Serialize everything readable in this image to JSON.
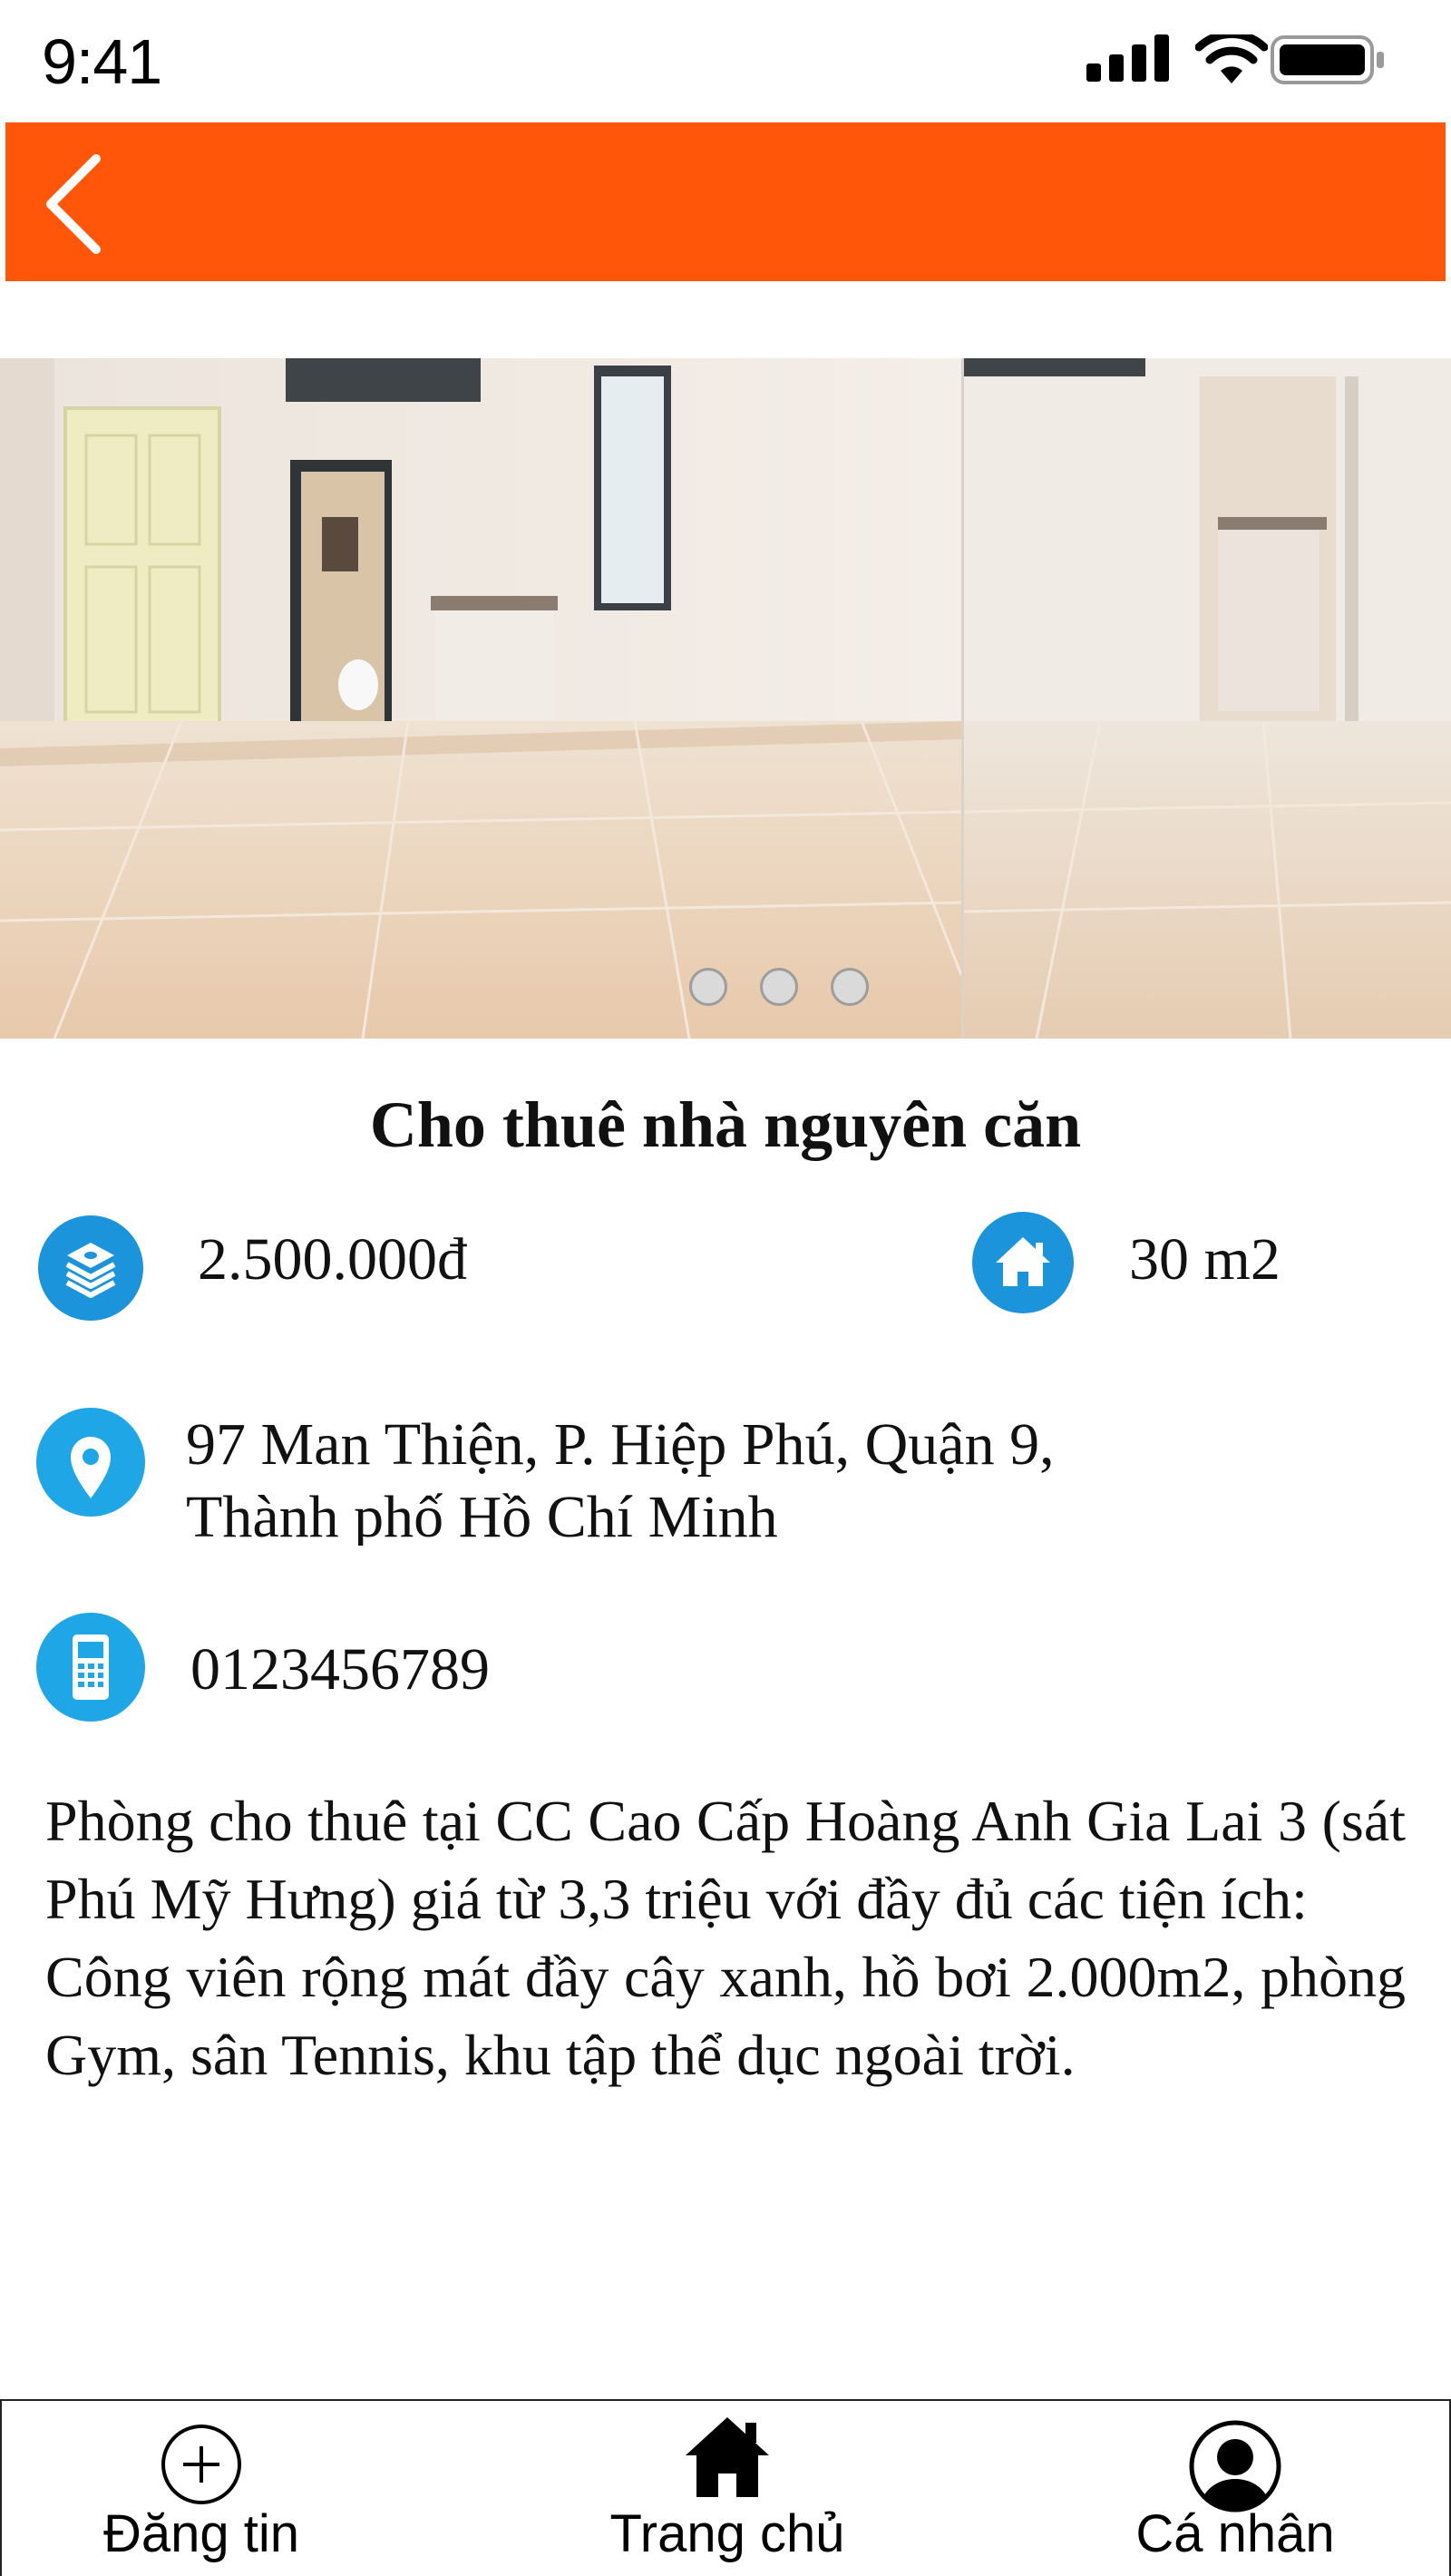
{
  "status_bar": {
    "time": "9:41"
  },
  "header": {
    "background_color": "#ff560a",
    "back_icon": "chevron-left-icon"
  },
  "gallery": {
    "photos": [
      "room-photo-main",
      "room-photo-secondary"
    ],
    "page_count": 3,
    "active_page": 0
  },
  "listing": {
    "title": "Cho thuê nhà nguyên căn",
    "price": "2.500.000đ",
    "area": "30 m2",
    "address_line1": "97 Man Thiện, P. Hiệp Phú, Quận 9,",
    "address_line2": "Thành phố Hồ Chí Minh",
    "phone": "0123456789",
    "description_p1": "Phòng cho thuê tại CC Cao Cấp Hoàng Anh Gia Lai 3 (sát Phú Mỹ Hưng) giá từ 3,3 triệu với đầy đủ các tiện ích:",
    "description_p2": "Công viên rộng mát đầy cây xanh, hồ bơi 2.000m2, phòng Gym, sân Tennis, khu tập thể dục ngoài trời.",
    "icons": {
      "price": "money-stack-icon",
      "area": "home-icon",
      "address": "location-pin-icon",
      "phone": "mobile-phone-icon"
    },
    "icon_color": "#1b94dc"
  },
  "bottom_nav": {
    "items": [
      {
        "label": "Đăng tin",
        "icon": "plus-circle-icon"
      },
      {
        "label": "Trang chủ",
        "icon": "home-icon"
      },
      {
        "label": "Cá nhân",
        "icon": "user-avatar-icon"
      }
    ]
  }
}
